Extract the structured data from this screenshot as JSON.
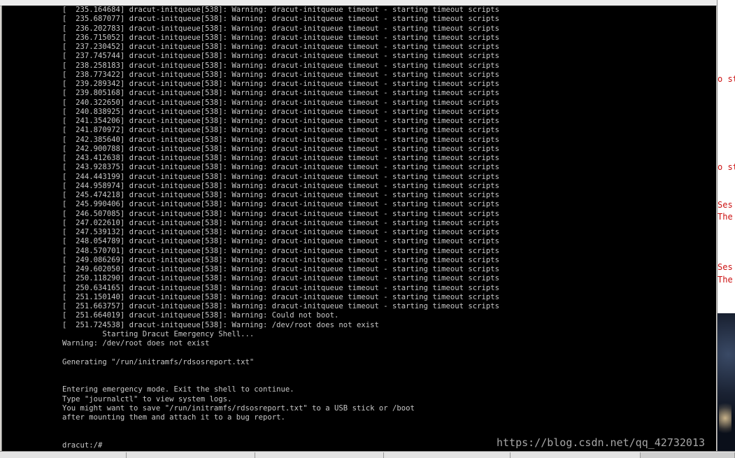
{
  "console": {
    "lines": [
      "[  235.164684] dracut-initqueue[538]: Warning: dracut-initqueue timeout - starting timeout scripts",
      "[  235.687077] dracut-initqueue[538]: Warning: dracut-initqueue timeout - starting timeout scripts",
      "[  236.202783] dracut-initqueue[538]: Warning: dracut-initqueue timeout - starting timeout scripts",
      "[  236.715052] dracut-initqueue[538]: Warning: dracut-initqueue timeout - starting timeout scripts",
      "[  237.230452] dracut-initqueue[538]: Warning: dracut-initqueue timeout - starting timeout scripts",
      "[  237.745744] dracut-initqueue[538]: Warning: dracut-initqueue timeout - starting timeout scripts",
      "[  238.258183] dracut-initqueue[538]: Warning: dracut-initqueue timeout - starting timeout scripts",
      "[  238.773422] dracut-initqueue[538]: Warning: dracut-initqueue timeout - starting timeout scripts",
      "[  239.289342] dracut-initqueue[538]: Warning: dracut-initqueue timeout - starting timeout scripts",
      "[  239.805168] dracut-initqueue[538]: Warning: dracut-initqueue timeout - starting timeout scripts",
      "[  240.322650] dracut-initqueue[538]: Warning: dracut-initqueue timeout - starting timeout scripts",
      "[  240.838925] dracut-initqueue[538]: Warning: dracut-initqueue timeout - starting timeout scripts",
      "[  241.354206] dracut-initqueue[538]: Warning: dracut-initqueue timeout - starting timeout scripts",
      "[  241.870972] dracut-initqueue[538]: Warning: dracut-initqueue timeout - starting timeout scripts",
      "[  242.385640] dracut-initqueue[538]: Warning: dracut-initqueue timeout - starting timeout scripts",
      "[  242.900788] dracut-initqueue[538]: Warning: dracut-initqueue timeout - starting timeout scripts",
      "[  243.412638] dracut-initqueue[538]: Warning: dracut-initqueue timeout - starting timeout scripts",
      "[  243.928375] dracut-initqueue[538]: Warning: dracut-initqueue timeout - starting timeout scripts",
      "[  244.443199] dracut-initqueue[538]: Warning: dracut-initqueue timeout - starting timeout scripts",
      "[  244.958974] dracut-initqueue[538]: Warning: dracut-initqueue timeout - starting timeout scripts",
      "[  245.474218] dracut-initqueue[538]: Warning: dracut-initqueue timeout - starting timeout scripts",
      "[  245.990406] dracut-initqueue[538]: Warning: dracut-initqueue timeout - starting timeout scripts",
      "[  246.507085] dracut-initqueue[538]: Warning: dracut-initqueue timeout - starting timeout scripts",
      "[  247.022610] dracut-initqueue[538]: Warning: dracut-initqueue timeout - starting timeout scripts",
      "[  247.539132] dracut-initqueue[538]: Warning: dracut-initqueue timeout - starting timeout scripts",
      "[  248.054789] dracut-initqueue[538]: Warning: dracut-initqueue timeout - starting timeout scripts",
      "[  248.570701] dracut-initqueue[538]: Warning: dracut-initqueue timeout - starting timeout scripts",
      "[  249.086269] dracut-initqueue[538]: Warning: dracut-initqueue timeout - starting timeout scripts",
      "[  249.602050] dracut-initqueue[538]: Warning: dracut-initqueue timeout - starting timeout scripts",
      "[  250.118290] dracut-initqueue[538]: Warning: dracut-initqueue timeout - starting timeout scripts",
      "[  250.634165] dracut-initqueue[538]: Warning: dracut-initqueue timeout - starting timeout scripts",
      "[  251.150140] dracut-initqueue[538]: Warning: dracut-initqueue timeout - starting timeout scripts",
      "[  251.663757] dracut-initqueue[538]: Warning: dracut-initqueue timeout - starting timeout scripts",
      "[  251.664019] dracut-initqueue[538]: Warning: Could not boot.",
      "[  251.724538] dracut-initqueue[538]: Warning: /dev/root does not exist",
      "         Starting Dracut Emergency Shell...",
      "Warning: /dev/root does not exist",
      "",
      "Generating \"/run/initramfs/rdsosreport.txt\"",
      "",
      "",
      "Entering emergency mode. Exit the shell to continue.",
      "Type \"journalctl\" to view system logs.",
      "You might want to save \"/run/initramfs/rdsosreport.txt\" to a USB stick or /boot",
      "after mounting them and attach it to a bug report.",
      "",
      "",
      "dracut:/#"
    ]
  },
  "right_panel": {
    "fragments": [
      "o st",
      "o st",
      "Ses",
      "The",
      "Ses",
      "The"
    ]
  },
  "watermark": "https://blog.csdn.net/qq_42732013",
  "colors": {
    "console_bg": "#000000",
    "console_fg": "#c8c8c8",
    "side_text": "#cc1111"
  }
}
